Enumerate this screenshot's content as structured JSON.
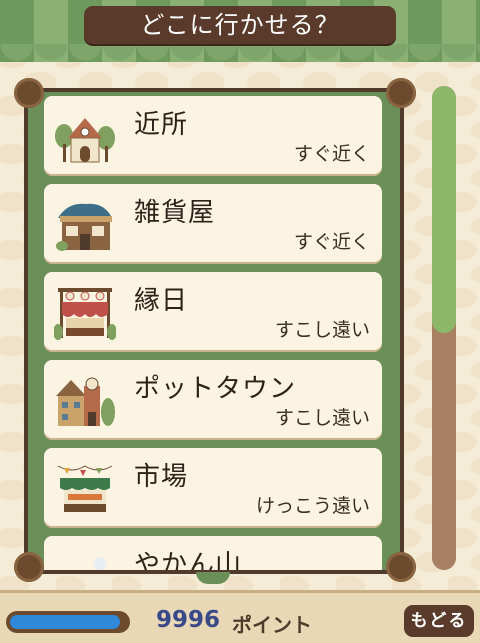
{
  "title": "どこに行かせる？",
  "destinations": [
    {
      "name": "近所",
      "distance": "すぐ近く",
      "icon": "house-icon"
    },
    {
      "name": "雑貨屋",
      "distance": "すぐ近く",
      "icon": "shop-icon"
    },
    {
      "name": "縁日",
      "distance": "すこし遠い",
      "icon": "festival-stall-icon"
    },
    {
      "name": "ポットタウン",
      "distance": "すこし遠い",
      "icon": "town-icon"
    },
    {
      "name": "市場",
      "distance": "けっこう遠い",
      "icon": "market-stall-icon"
    },
    {
      "name": "やかん山",
      "distance": "",
      "icon": "mountain-icon"
    }
  ],
  "scroll_fraction_visible": 0.51,
  "points": {
    "value": "9996",
    "label": "ポイント",
    "bar_fill": 0.95
  },
  "back_label": "もどる"
}
